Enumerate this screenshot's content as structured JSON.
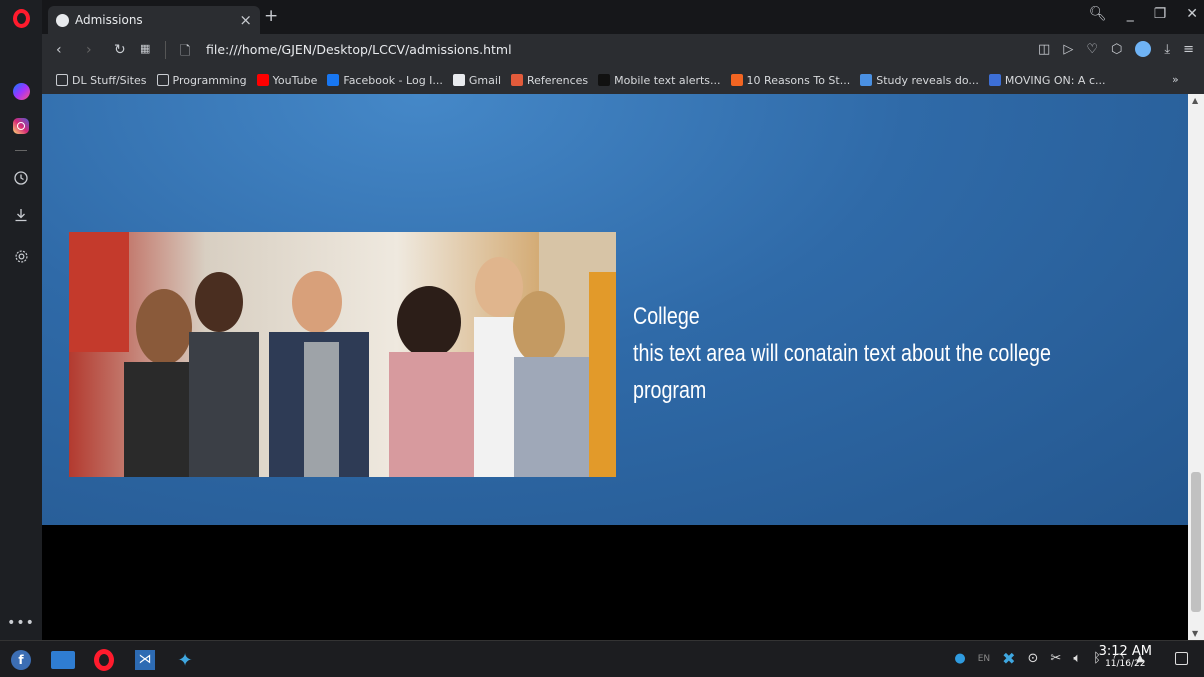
{
  "browser": {
    "tab_title": "Admissions",
    "tab_close": "×",
    "new_tab": "+",
    "url": "file:///home/GJEN/Desktop/LCCV/admissions.html",
    "bookmarks": [
      {
        "label": "DL Stuff/Sites",
        "icon": "folder-icon",
        "color": "#c9ccd1"
      },
      {
        "label": "Programming",
        "icon": "folder-icon",
        "color": "#c9ccd1"
      },
      {
        "label": "YouTube",
        "icon": "youtube-icon",
        "color": "#ff0000"
      },
      {
        "label": "Facebook - Log I...",
        "icon": "facebook-icon",
        "color": "#1877f2"
      },
      {
        "label": "Gmail",
        "icon": "document-icon",
        "color": "#e8eaed"
      },
      {
        "label": "References",
        "icon": "references-icon",
        "color": "#e25b3b"
      },
      {
        "label": "Mobile text alerts...",
        "icon": "w-icon",
        "color": "#111111"
      },
      {
        "label": "10 Reasons To St...",
        "icon": "check-icon",
        "color": "#f26522"
      },
      {
        "label": "Study reveals do...",
        "icon": "news-icon",
        "color": "#4a90e2"
      },
      {
        "label": "MOVING ON: A c...",
        "icon": "diamond-icon",
        "color": "#3d6fd6"
      }
    ],
    "bookmarks_more": "»"
  },
  "page": {
    "hero_title": "College",
    "hero_line1": "this text area will conatain text about the college",
    "hero_line2": "program"
  },
  "taskbar": {
    "time": "3:12 AM",
    "date": "11/16/22",
    "lang": "EN"
  },
  "colors": {
    "hero_blue": "#2f6aa8",
    "opera_red": "#ff1b2d"
  }
}
